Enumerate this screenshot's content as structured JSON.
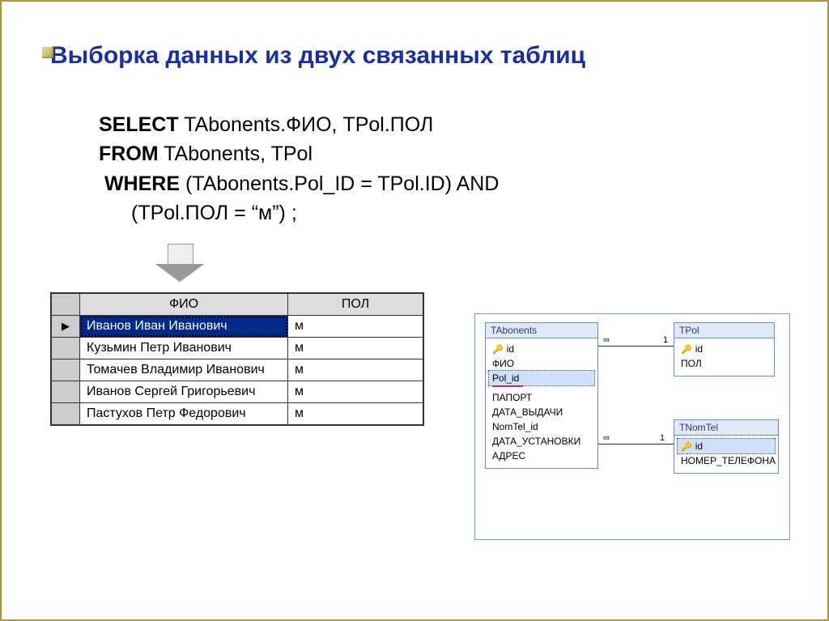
{
  "title": "Выборка данных из двух связанных таблиц",
  "sql": {
    "select_kw": "SELECT",
    "select_rest": " TAbonents.ФИО, TPol.ПОЛ",
    "from_kw": "FROM",
    "from_rest": " TAbonents, TPol",
    "where_kw": "WHERE",
    "where_rest": " (TAbonents.Pol_ID = TPol.ID) AND",
    "where_line2": "(TPol.ПОЛ = “м”) ;"
  },
  "result": {
    "headers": {
      "fio": "ФИО",
      "pol": "ПОЛ"
    },
    "rows": [
      {
        "fio": "Иванов Иван Иванович",
        "pol": "м",
        "current": true
      },
      {
        "fio": "Кузьмин Петр Иванович",
        "pol": "м"
      },
      {
        "fio": "Томачев Владимир Иванович",
        "pol": "м"
      },
      {
        "fio": "Иванов Сергей Григорьевич",
        "pol": "м"
      },
      {
        "fio": "Пастухов Петр Федорович",
        "pol": "м"
      }
    ]
  },
  "schema": {
    "tabonents": {
      "title": "TAbonents",
      "fields": [
        "id",
        "ФИО",
        "Pol_id",
        "ПАПОРТ",
        "ДАТА_ВЫДАЧИ",
        "NomTel_id",
        "ДАТА_УСТАНОВКИ",
        "АДРЕС"
      ]
    },
    "tpol": {
      "title": "TPol",
      "fields": [
        "id",
        "ПОЛ"
      ]
    },
    "tnomtel": {
      "title": "TNomTel",
      "fields": [
        "id",
        "НОМЕР_ТЕЛЕФОНА"
      ]
    },
    "rel": {
      "inf": "∞",
      "one": "1"
    }
  }
}
